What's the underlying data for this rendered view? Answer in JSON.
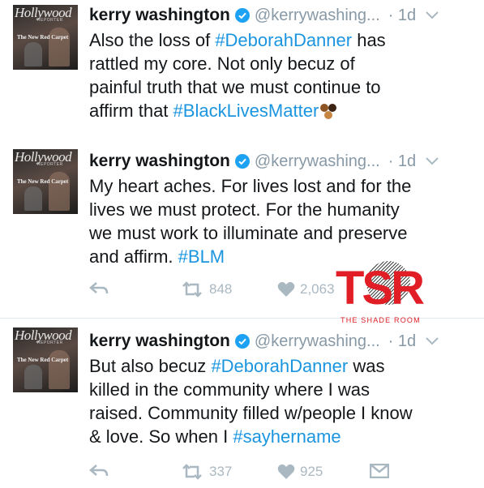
{
  "tweets": [
    {
      "avatar": {
        "masthead": "Hollywood",
        "subtitle": "REPORTER",
        "cover_line": "The New Red Carpet"
      },
      "name": "kerry washington",
      "handle": "@kerrywashing...",
      "time": "· 1d",
      "lines": [
        [
          {
            "t": "Also the loss of "
          },
          {
            "t": "#DeborahDanner",
            "tag": true
          },
          {
            "t": " has"
          }
        ],
        [
          {
            "t": "rattled my core. Not only becuz of"
          }
        ],
        [
          {
            "t": "painful truth that we must continue to"
          }
        ],
        [
          {
            "t": "affirm that "
          },
          {
            "t": "#BlackLivesMatter",
            "tag": true
          }
        ]
      ]
    },
    {
      "avatar": {
        "masthead": "Hollywood",
        "subtitle": "REPORTER",
        "cover_line": "The New Red Carpet"
      },
      "name": "kerry washington",
      "handle": "@kerrywashing...",
      "time": "· 1d",
      "lines": [
        [
          {
            "t": "My heart aches. For lives lost and for the"
          }
        ],
        [
          {
            "t": "lives we must protect. For the humanity"
          }
        ],
        [
          {
            "t": "we must work to illuminate and preserve"
          }
        ],
        [
          {
            "t": "and affirm. "
          },
          {
            "t": "#BLM",
            "tag": true
          }
        ]
      ],
      "retweets": "848",
      "likes": "2,063"
    },
    {
      "avatar": {
        "masthead": "Hollywood",
        "subtitle": "REPORTER",
        "cover_line": "The New Red Carpet"
      },
      "name": "kerry washington",
      "handle": "@kerrywashing...",
      "time": "· 1d",
      "lines": [
        [
          {
            "t": "But also becuz "
          },
          {
            "t": "#DeborahDanner",
            "tag": true
          },
          {
            "t": " was"
          }
        ],
        [
          {
            "t": "killed in the community where I was"
          }
        ],
        [
          {
            "t": "raised. Community filled w/people I know"
          }
        ],
        [
          {
            "t": "& love. So when I "
          },
          {
            "t": "#sayhername",
            "tag": true
          }
        ]
      ],
      "retweets": "337",
      "likes": "925"
    }
  ],
  "watermark": {
    "letters": "TSR",
    "caption": "THE SHADE ROOM"
  },
  "colors": {
    "link": "#1b95e0",
    "muted": "#8899a6",
    "action": "#aab8c2",
    "verified": "#1da1f2",
    "brand_red": "#e11d25"
  }
}
